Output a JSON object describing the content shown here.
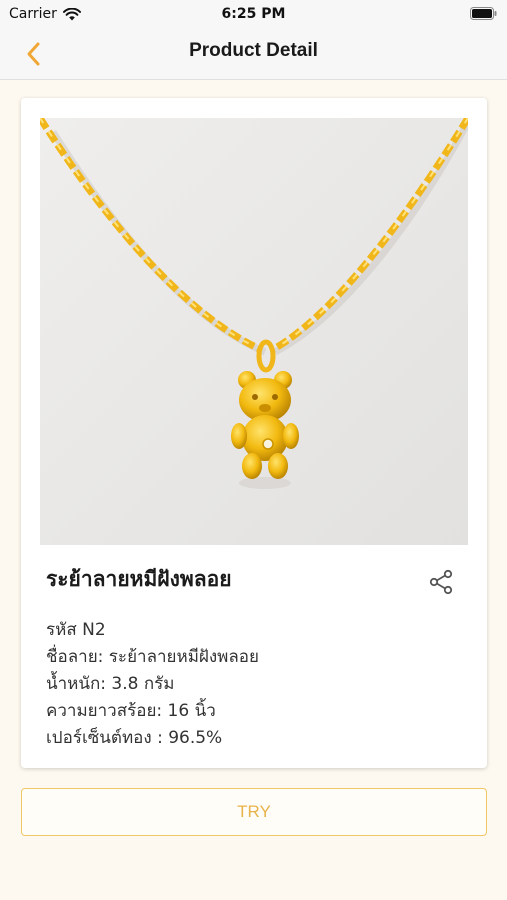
{
  "status_bar": {
    "carrier": "Carrier",
    "time": "6:25 PM"
  },
  "nav": {
    "title": "Product Detail"
  },
  "product": {
    "name": "ระย้าลายหมีฝังพลอย",
    "image_alt": "gold-necklace-teddy-bear-pendant",
    "details": [
      "รหัส N2",
      "ชื่อลาย: ระย้าลายหมีฝังพลอย",
      "น้ำหนัก: 3.8 กรัม",
      "ความยาวสร้อย: 16 นิ้ว",
      "เปอร์เซ็นต์ทอง : 96.5%"
    ]
  },
  "actions": {
    "try_label": "TRY"
  },
  "colors": {
    "accent": "#f0a735",
    "try_text": "#e7b34a",
    "try_border": "#f0c766",
    "page_bg": "#fdf9f0"
  }
}
